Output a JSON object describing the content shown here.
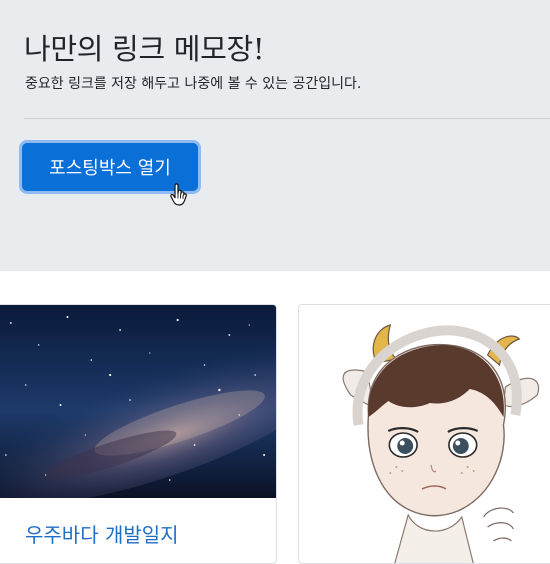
{
  "header": {
    "title": "나만의 링크 메모장!",
    "subtitle": "중요한 링크를 저장 해두고 나중에 볼 수 있는 공간입니다.",
    "open_button_label": "포스팅박스 열기"
  },
  "cards": [
    {
      "title": "우주바다 개발일지",
      "image": "milky-way-night-sky-photo"
    },
    {
      "title": "",
      "image": "drawn-character-with-horns-illustration"
    }
  ],
  "colors": {
    "jumbotron_bg": "#e9ecef",
    "button_bg": "#0b6fd8",
    "card_title": "#1f6fc7"
  }
}
